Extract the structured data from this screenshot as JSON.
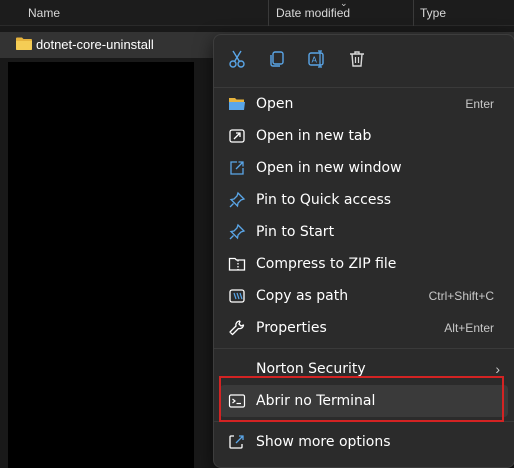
{
  "header": {
    "col_name": "Name",
    "col_date": "Date modified",
    "col_type": "Type"
  },
  "file": {
    "name": "dotnet-core-uninstall",
    "icon": "folder-icon"
  },
  "toolbar": [
    {
      "icon": "cut-icon"
    },
    {
      "icon": "copy-icon"
    },
    {
      "icon": "rename-icon"
    },
    {
      "icon": "delete-icon"
    }
  ],
  "menu": {
    "items": [
      {
        "label": "Open",
        "shortcut": "Enter",
        "icon": "folder-open-icon"
      },
      {
        "label": "Open in new tab",
        "shortcut": "",
        "icon": "new-tab-icon"
      },
      {
        "label": "Open in new window",
        "shortcut": "",
        "icon": "new-window-icon"
      },
      {
        "label": "Pin to Quick access",
        "shortcut": "",
        "icon": "pin-icon"
      },
      {
        "label": "Pin to Start",
        "shortcut": "",
        "icon": "pin-start-icon"
      },
      {
        "label": "Compress to ZIP file",
        "shortcut": "",
        "icon": "zip-icon"
      },
      {
        "label": "Copy as path",
        "shortcut": "Ctrl+Shift+C",
        "icon": "copy-path-icon"
      },
      {
        "label": "Properties",
        "shortcut": "Alt+Enter",
        "icon": "wrench-icon"
      }
    ],
    "norton": {
      "label": "Norton Security",
      "icon": "chevron-right-icon"
    },
    "terminal": {
      "label": "Abrir no Terminal",
      "icon": "terminal-icon"
    },
    "more": {
      "label": "Show more options",
      "icon": "more-options-icon"
    }
  },
  "colors": {
    "accent": "#5aa6e8",
    "folder": "#f2c94c",
    "highlight": "#d32323"
  }
}
